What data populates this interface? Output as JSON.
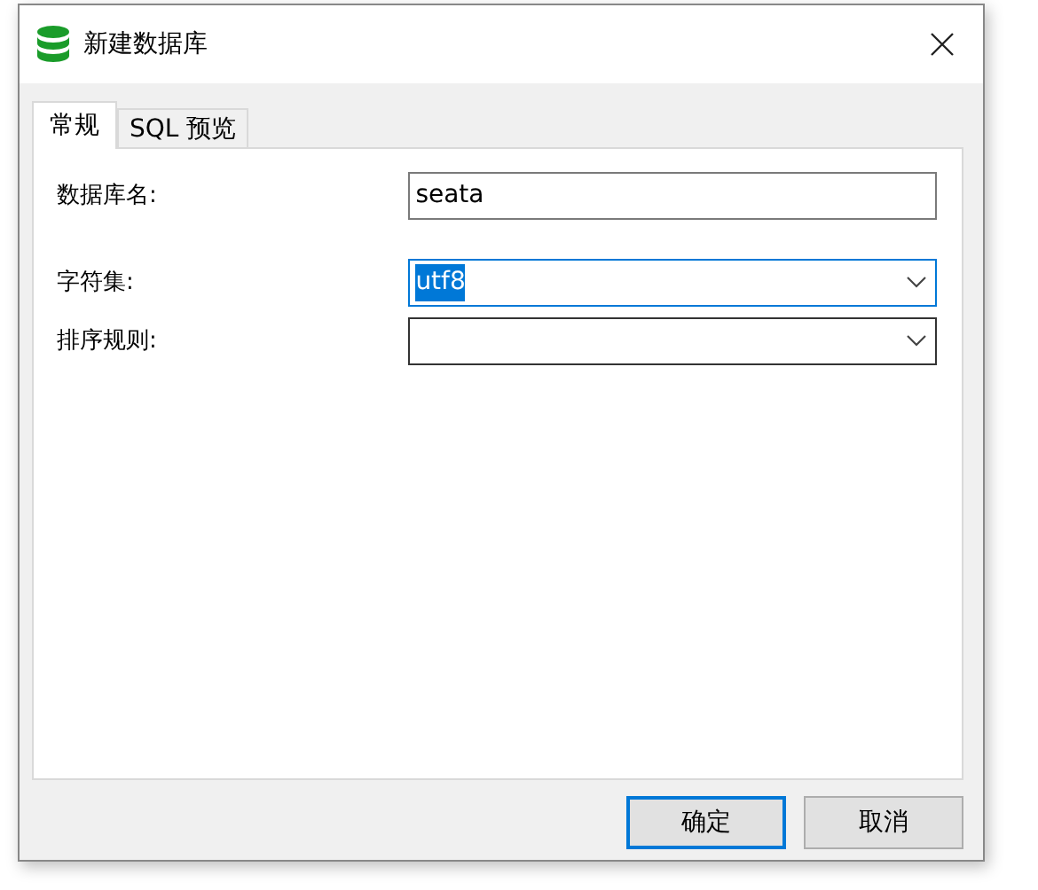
{
  "window": {
    "title": "新建数据库"
  },
  "tabs": [
    {
      "label": "常规",
      "selected": true
    },
    {
      "label": "SQL 预览",
      "selected": false
    }
  ],
  "fields": [
    {
      "kind": "text",
      "label": "数据库名:",
      "value": "seata",
      "focused": false
    },
    {
      "kind": "select",
      "label": "字符集:",
      "value": "utf8",
      "focused": true,
      "text_selected": true
    },
    {
      "kind": "select",
      "label": "排序规则:",
      "focused": false
    }
  ],
  "buttons": [
    {
      "label": "确定",
      "default": true
    },
    {
      "label": "取消",
      "default": false
    }
  ]
}
